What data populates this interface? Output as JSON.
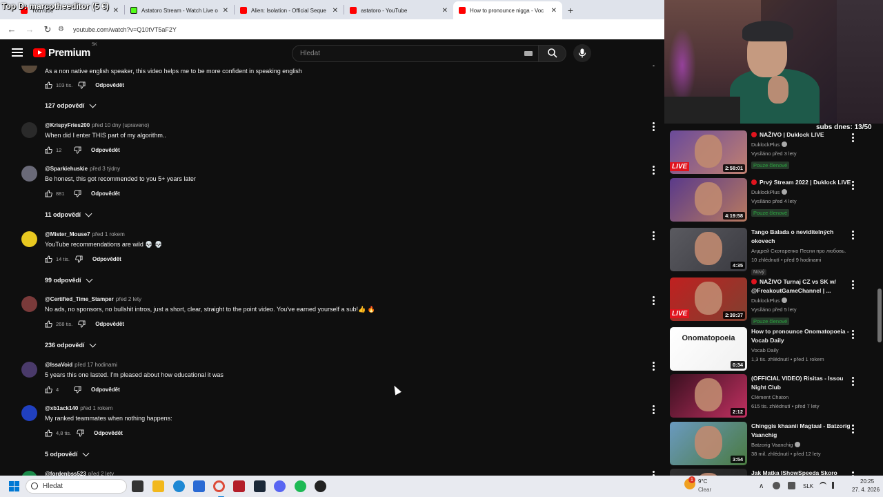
{
  "overlay": {
    "text": "Top D: marcotheeditor (5 €)"
  },
  "browser": {
    "tabs": [
      {
        "title": "YouTube",
        "favicon": "youtube-favicon",
        "active": false
      },
      {
        "title": "Astatoro Stream - Watch Live o",
        "favicon": "kick-favicon",
        "active": false
      },
      {
        "title": "Alien: Isolation - Official Seque",
        "favicon": "youtube-favicon",
        "active": false
      },
      {
        "title": "astatoro - YouTube",
        "favicon": "youtube-favicon",
        "active": false
      },
      {
        "title": "How to pronounce nigga - Voc",
        "favicon": "youtube-favicon",
        "active": true
      }
    ],
    "url": "youtube.com/watch?v=Q10tVT5aF2Y"
  },
  "youtube": {
    "logo_text": "Premium",
    "country": "SK",
    "search_placeholder": "Hledat"
  },
  "comments": [
    {
      "handle": "",
      "time": "",
      "text": "As a non native english speaker, this video helps me to be more confident in speaking english",
      "likes": "103 tis.",
      "reply_label": "Odpovědět",
      "replies": "127 odpovědí",
      "avatar_color": "#5a4a3a"
    },
    {
      "handle": "@KrispyFries200",
      "time": "před 10 dny (upraveno)",
      "text": "When did I enter THIS part of my algorithm..",
      "likes": "12",
      "reply_label": "Odpovědět",
      "replies": "",
      "avatar_color": "#2a2a2a"
    },
    {
      "handle": "@Sparkiehuskie",
      "time": "před 3 týdny",
      "text": "Be honest, this got recommended to you 5+ years later",
      "likes": "881",
      "reply_label": "Odpovědět",
      "replies": "11 odpovědí",
      "avatar_color": "#6a6a78"
    },
    {
      "handle": "@Mister_Mouse7",
      "time": "před 1 rokem",
      "text": "YouTube recommendations are wild 💀 💀",
      "likes": "14 tis.",
      "reply_label": "Odpovědět",
      "replies": "99 odpovědí",
      "avatar_color": "#e8c820"
    },
    {
      "handle": "@Certified_Time_Stamper",
      "time": "před 2 lety",
      "text": "No ads, no sponsors, no bullshit intros, just a short, clear, straight to the point video. You've earned yourself a sub!👍 🔥",
      "likes": "268 tis.",
      "reply_label": "Odpovědět",
      "replies": "236 odpovědí",
      "avatar_color": "#7a3a3a"
    },
    {
      "handle": "@IssaVoid",
      "time": "před 17 hodinami",
      "text": "5 years this one lasted. I'm pleased about how educational it was",
      "likes": "4",
      "reply_label": "Odpovědět",
      "replies": "",
      "avatar_color": "#4a3a6a"
    },
    {
      "handle": "@xb1ack140",
      "time": "před 1 rokem",
      "text": "My ranked teammates when nothing happens:",
      "likes": "4,8 tis.",
      "reply_label": "Odpovědět",
      "replies": "5 odpovědí",
      "avatar_color": "#2040c0"
    },
    {
      "handle": "@fordenbss523",
      "time": "před 2 lety",
      "text": "",
      "likes": "",
      "reply_label": "",
      "replies": "",
      "avatar_color": "#1a8a4a"
    }
  ],
  "stream": {
    "subs_label": "subs dnes: 13/50"
  },
  "recommendations": [
    {
      "title": "NAŽIVO | Duklock LIVE",
      "live_icon": true,
      "channel": "DuklockPlus",
      "verified": true,
      "meta": "Vysíláno před 3 lety",
      "badge": "Pouze členové",
      "duration": "2:58:01",
      "live_thumb": true,
      "thumb_colors": [
        "#6a4a9a",
        "#c08070"
      ]
    },
    {
      "title": "Prvý Stream 2022 | Duklock LIVE",
      "live_icon": true,
      "channel": "DuklockPlus",
      "verified": true,
      "meta": "Vysíláno před 4 lety",
      "badge": "Pouze členové",
      "duration": "4:19:58",
      "live_thumb": false,
      "thumb_colors": [
        "#5a3a8a",
        "#b87a60"
      ]
    },
    {
      "title": "Tango Balada o neviditelných okovech",
      "live_icon": false,
      "channel": "Андрей Скотаренко Песни про любовь.",
      "verified": false,
      "meta": "10 zhlédnutí • před 9 hodinami",
      "badge": "Nový",
      "duration": "4:35",
      "live_thumb": false,
      "thumb_colors": [
        "#5a5a60",
        "#3a3a40"
      ]
    },
    {
      "title": "NAŽIVO Turnaj CZ vs SK w/ @FreakoutGameChannel | ...",
      "live_icon": true,
      "channel": "DuklockPlus",
      "verified": true,
      "meta": "Vysíláno před 5 lety",
      "badge": "Pouze členové",
      "duration": "2:39:37",
      "live_thumb": true,
      "thumb_colors": [
        "#c02020",
        "#804030"
      ]
    },
    {
      "title": "How to pronounce Onomatopoeia - Vocab Daily",
      "live_icon": false,
      "channel": "Vocab Daily",
      "verified": false,
      "meta": "1,3 tis. zhlédnutí • před 1 rokem",
      "badge": "",
      "duration": "0:34",
      "live_thumb": false,
      "thumb_colors": [
        "#ffffff",
        "#f0f0f0"
      ],
      "thumb_text": "Onomatopoeia"
    },
    {
      "title": "(OFFICIAL VIDEO) Risitas - Issou Night Club",
      "live_icon": false,
      "channel": "Clément Chaton",
      "verified": false,
      "meta": "615 tis. zhlédnutí • před 7 lety",
      "badge": "",
      "duration": "2:12",
      "live_thumb": false,
      "thumb_colors": [
        "#3a1020",
        "#c03060"
      ]
    },
    {
      "title": "Chinggis khaanii Magtaal - Batzorig Vaanchig",
      "live_icon": false,
      "channel": "Batzorig Vaanchig",
      "verified": true,
      "meta": "38 mil. zhlédnutí • před 12 lety",
      "badge": "",
      "duration": "3:54",
      "live_thumb": false,
      "thumb_colors": [
        "#6a9ac0",
        "#4a7a40"
      ]
    },
    {
      "title": "Jak Matka IShowSpeeda Skoro",
      "live_icon": false,
      "channel": "",
      "verified": false,
      "meta": "",
      "badge": "",
      "duration": "",
      "live_thumb": false,
      "thumb_colors": [
        "#303030",
        "#202020"
      ]
    }
  ],
  "taskbar": {
    "search_placeholder": "Hledat",
    "weather_temp": "9°C",
    "weather_desc": "Clear",
    "weather_badge": "1",
    "language": "SLK",
    "time": "20:25",
    "date": "27. 4. 2026"
  }
}
